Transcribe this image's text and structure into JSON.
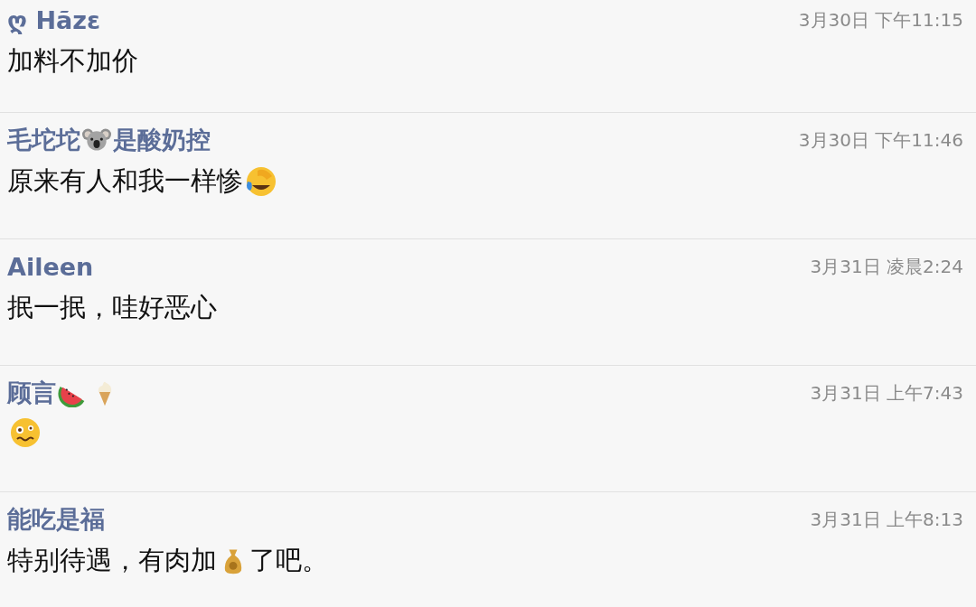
{
  "comments": [
    {
      "name": [
        {
          "kind": "text",
          "text": "ღ Hãzɛ"
        }
      ],
      "time": "3月30日 下午11:15",
      "message": [
        {
          "kind": "text",
          "text": "加料不加价"
        }
      ]
    },
    {
      "name": [
        {
          "kind": "text",
          "text": "毛坨坨"
        },
        {
          "kind": "koala"
        },
        {
          "kind": "text",
          "text": "是酸奶控"
        }
      ],
      "time": "3月30日 下午11:46",
      "message": [
        {
          "kind": "text",
          "text": "原来有人和我一样惨"
        },
        {
          "kind": "laughing"
        }
      ]
    },
    {
      "name": [
        {
          "kind": "text",
          "text": "Aileen"
        }
      ],
      "time": "3月31日 凌晨2:24",
      "message": [
        {
          "kind": "text",
          "text": "抿一抿，哇好恶心"
        }
      ]
    },
    {
      "name": [
        {
          "kind": "text",
          "text": "顾言"
        },
        {
          "kind": "watermelon"
        },
        {
          "kind": "icecream"
        }
      ],
      "time": "3月31日 上午7:43",
      "message": [
        {
          "kind": "woozy"
        }
      ]
    },
    {
      "name": [
        {
          "kind": "text",
          "text": "能吃是福"
        }
      ],
      "time": "3月31日 上午8:13",
      "message": [
        {
          "kind": "text",
          "text": "特别待遇，有肉加"
        },
        {
          "kind": "moneybag"
        },
        {
          "kind": "text",
          "text": "了吧。"
        }
      ]
    }
  ]
}
